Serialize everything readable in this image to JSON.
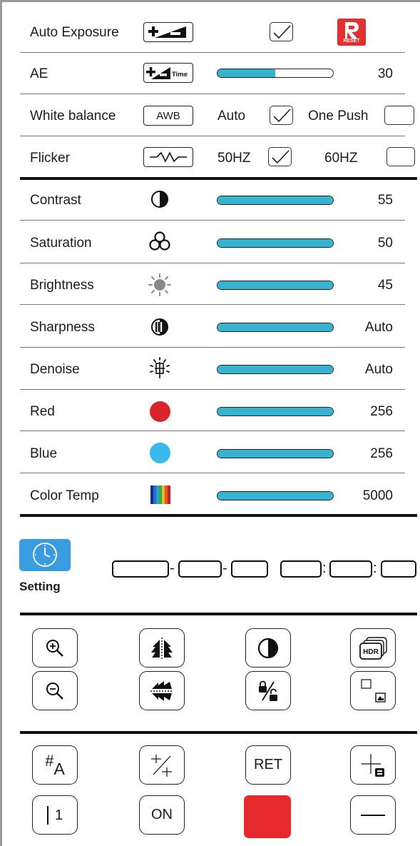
{
  "colors": {
    "slider_fill": "#35b3d0",
    "reset_red": "#e2302f",
    "red_dot": "#d9252a",
    "blue_dot": "#3ab9ec",
    "setting_blue": "#3a9de0",
    "red_button": "#e6292d"
  },
  "exposure": {
    "auto_exposure_label": "Auto Exposure",
    "auto_exposure_checked": true,
    "reset_text": "RESET",
    "ae_label": "AE",
    "ae_icon_text": "Time",
    "ae_value": "30",
    "ae_level": 0.5
  },
  "white_balance": {
    "label": "White balance",
    "button_text": "AWB",
    "auto_label": "Auto",
    "auto_checked": true,
    "one_push_label": "One Push",
    "one_push_checked": false
  },
  "flicker": {
    "label": "Flicker",
    "hz50_label": "50HZ",
    "hz50_checked": true,
    "hz60_label": "60HZ",
    "hz60_checked": false
  },
  "image_settings": [
    {
      "label": "Contrast",
      "icon": "contrast-icon",
      "value": "55"
    },
    {
      "label": "Saturation",
      "icon": "saturation-icon",
      "value": "50"
    },
    {
      "label": "Brightness",
      "icon": "brightness-icon",
      "value": "45"
    },
    {
      "label": "Sharpness",
      "icon": "sharpness-icon",
      "value": "Auto"
    },
    {
      "label": "Denoise",
      "icon": "denoise-icon",
      "value": "Auto"
    },
    {
      "label": "Red",
      "icon": "red-dot-icon",
      "value": "256"
    },
    {
      "label": "Blue",
      "icon": "blue-dot-icon",
      "value": "256"
    },
    {
      "label": "Color Temp",
      "icon": "color-temp-icon",
      "value": "5000"
    }
  ],
  "time": {
    "setting_label": "Setting",
    "separators": [
      "-",
      "-",
      ":",
      ":"
    ]
  },
  "toolbar": {
    "hdr_text": "HDR",
    "grid_text": "#",
    "grid_sub": "A",
    "ret_text": "RET",
    "line_number": "1",
    "on_text": "ON"
  }
}
